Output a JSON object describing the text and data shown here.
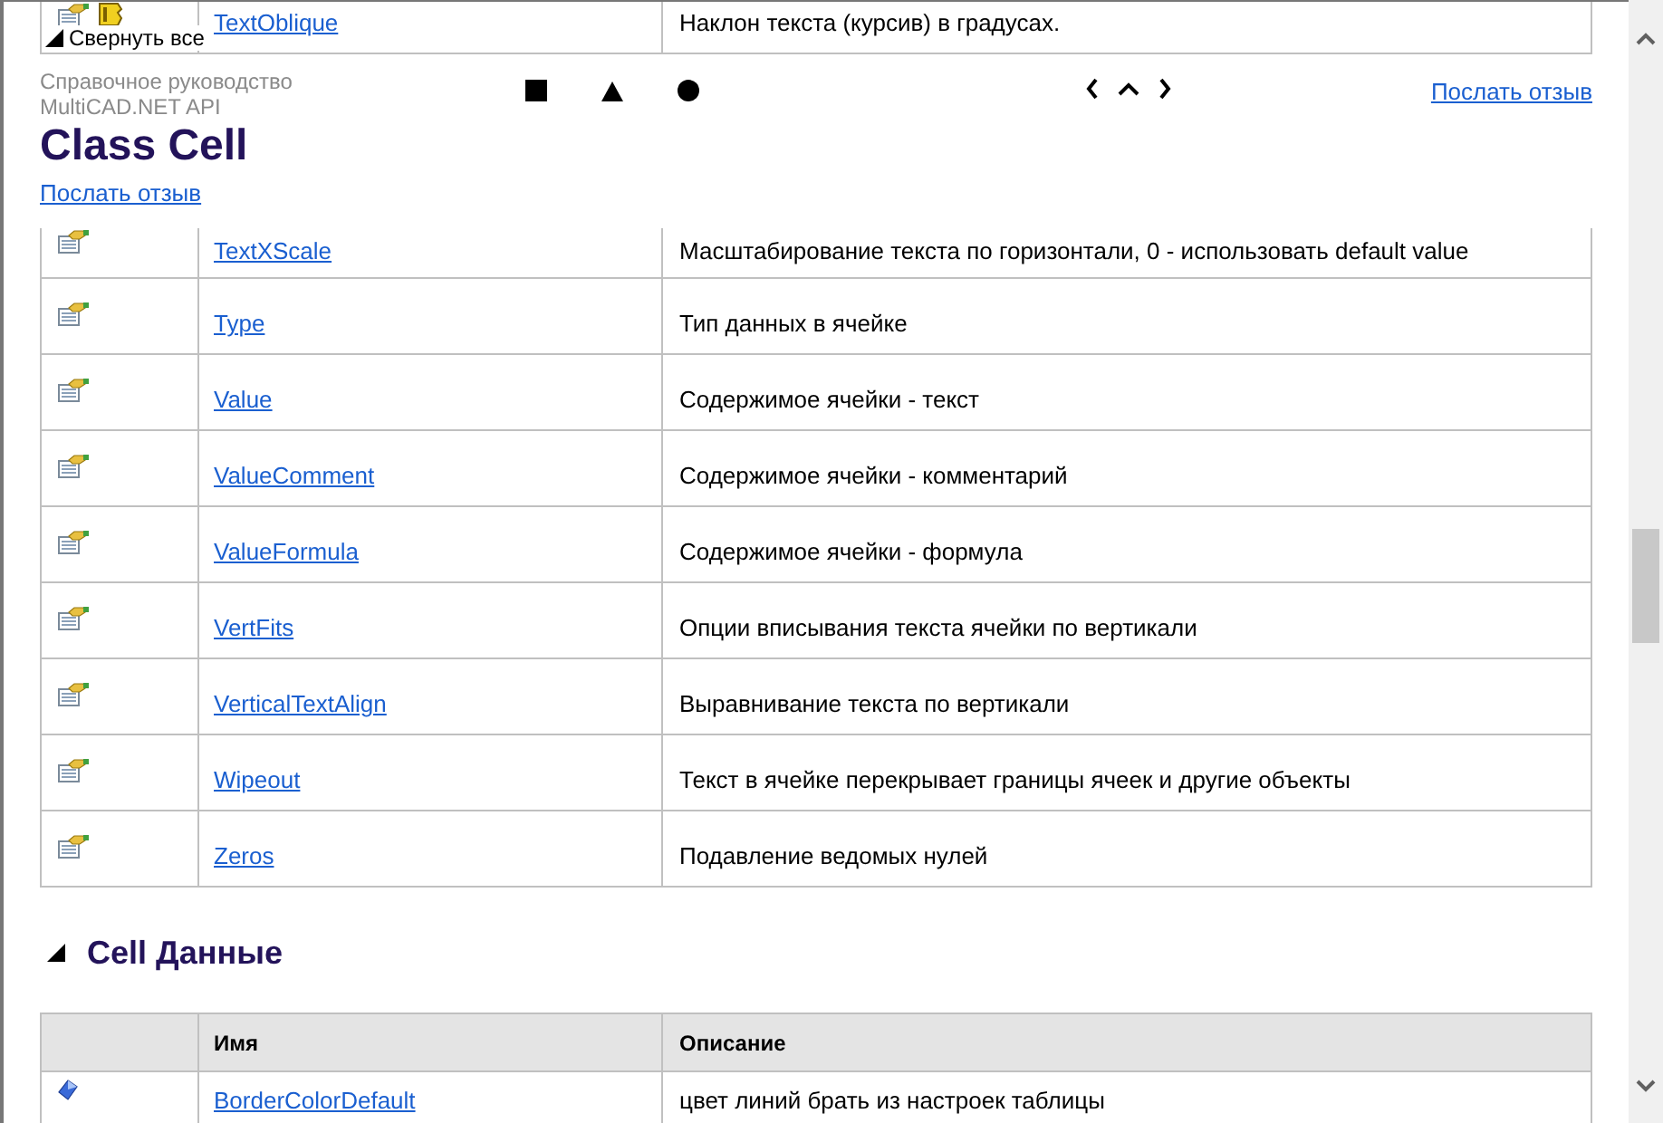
{
  "collapse_all": {
    "label": "Свернуть все",
    "expanded": true
  },
  "top_rows": [
    {
      "kind": "static_property",
      "name": "TextOblique",
      "description": "Наклон текста (курсив) в градусах."
    }
  ],
  "header": {
    "breadcrumb": [
      "Справочное руководство",
      "MultiCAD.NET API"
    ],
    "top_feedback_link": "Послать отзыв",
    "title": "Class Cell",
    "feedback_link": "Послать отзыв"
  },
  "properties_table": {
    "rows": [
      {
        "kind": "property",
        "name": "TextXScale",
        "description": "Масштабирование текста по горизонтали, 0 - использовать default value"
      },
      {
        "kind": "property",
        "name": "Type",
        "description": "Тип данных в ячейке"
      },
      {
        "kind": "property",
        "name": "Value",
        "description": "Содержимое ячейки - текст"
      },
      {
        "kind": "property",
        "name": "ValueComment",
        "description": "Содержимое ячейки - комментарий"
      },
      {
        "kind": "property",
        "name": "ValueFormula",
        "description": "Содержимое ячейки - формула"
      },
      {
        "kind": "property",
        "name": "VertFits",
        "description": "Опции вписывания текста ячейки по вертикали"
      },
      {
        "kind": "property",
        "name": "VerticalTextAlign",
        "description": "Выравнивание текста по вертикали"
      },
      {
        "kind": "property",
        "name": "Wipeout",
        "description": "Текст в ячейке перекрывает границы ячеек и другие объекты"
      },
      {
        "kind": "property",
        "name": "Zeros",
        "description": "Подавление ведомых нулей"
      }
    ]
  },
  "section": {
    "title": "Cell Данные",
    "expanded": true
  },
  "data_table": {
    "columns": [
      "Имя",
      "Описание"
    ],
    "rows": [
      {
        "kind": "field",
        "name": "BorderColorDefault",
        "description": "цвет линий брать из настроек таблицы"
      }
    ]
  }
}
